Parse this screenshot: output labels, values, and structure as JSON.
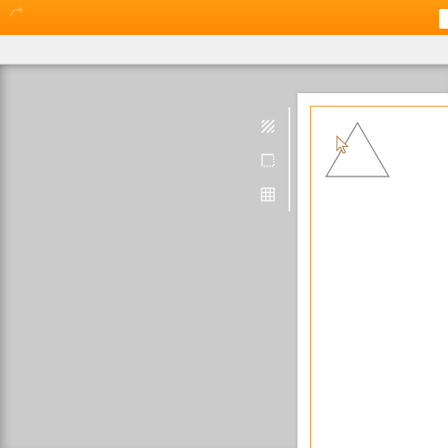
{
  "colors": {
    "title_bar": "#ff8c00",
    "toolbar": "#f0f0f0",
    "workspace": "#cbcbcb",
    "page": "#ffffff",
    "margin_guide": "#f59c2c",
    "shape_stroke": "#7a7a7a",
    "icon": "#ffffff"
  },
  "title_bar": {
    "buttons": [
      {
        "icon": "redo-icon"
      }
    ]
  },
  "view_tools": [
    {
      "icon": "hatch-icon"
    },
    {
      "icon": "selection-rect-icon"
    },
    {
      "icon": "grid-icon"
    }
  ],
  "canvas": {
    "shapes": [
      {
        "type": "triangle"
      }
    ],
    "cursor": "arrow"
  }
}
